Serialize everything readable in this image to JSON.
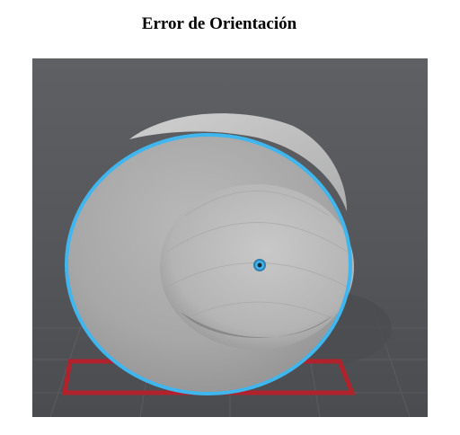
{
  "title": "Error de Orientación",
  "viewport": {
    "object_type": "sphere-bowl-model",
    "outline_color": "#3fb6ee",
    "build_plate_color": "#b0232c",
    "background_color": "#56585c",
    "icons": [
      "pivot-point-icon"
    ]
  }
}
